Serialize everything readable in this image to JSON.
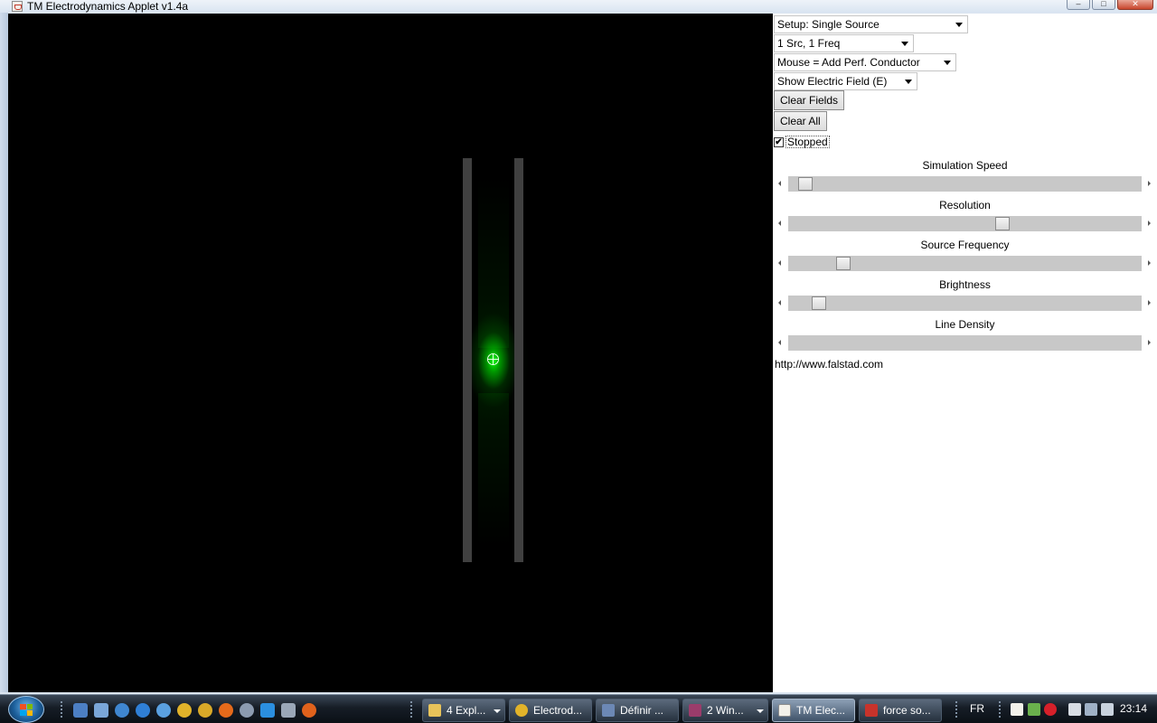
{
  "window": {
    "title": "TM Electrodynamics Applet v1.4a",
    "minimize": "–",
    "maximize": "□",
    "close": "✕"
  },
  "controls": {
    "setup_select": "Setup: Single Source",
    "source_select": "1 Src, 1 Freq",
    "mouse_select": "Mouse = Add Perf. Conductor",
    "view_select": "Show Electric Field (E)",
    "clear_fields_button": "Clear Fields",
    "clear_all_button": "Clear All",
    "stopped_checkbox": {
      "label": "Stopped",
      "checked": true,
      "mark": "✔"
    }
  },
  "sliders": [
    {
      "label": "Simulation Speed",
      "value_fraction": 0.03
    },
    {
      "label": "Resolution",
      "value_fraction": 0.61
    },
    {
      "label": "Source Frequency",
      "value_fraction": 0.14
    },
    {
      "label": "Brightness",
      "value_fraction": 0.07
    },
    {
      "label": "Line Density",
      "value_fraction": null
    }
  ],
  "url_text": "http://www.falstad.com",
  "simulation": {
    "field_color": "#00ff00",
    "conductor_color": "#404040",
    "background_color": "#000000"
  },
  "taskbar": {
    "tasks": [
      {
        "label": "4 Expl...",
        "icon": "folder-icon",
        "has_menu": true
      },
      {
        "label": "Electrod...",
        "icon": "chrome-icon",
        "has_menu": false
      },
      {
        "label": "Définir ...",
        "icon": "tool-icon",
        "has_menu": false
      },
      {
        "label": "2 Win...",
        "icon": "winrar-icon",
        "has_menu": true
      },
      {
        "label": "TM Elec...",
        "icon": "java-icon",
        "has_menu": false,
        "active": true
      },
      {
        "label": "force so...",
        "icon": "filezilla-icon",
        "has_menu": false
      }
    ],
    "language": "FR",
    "clock": "23:14"
  }
}
